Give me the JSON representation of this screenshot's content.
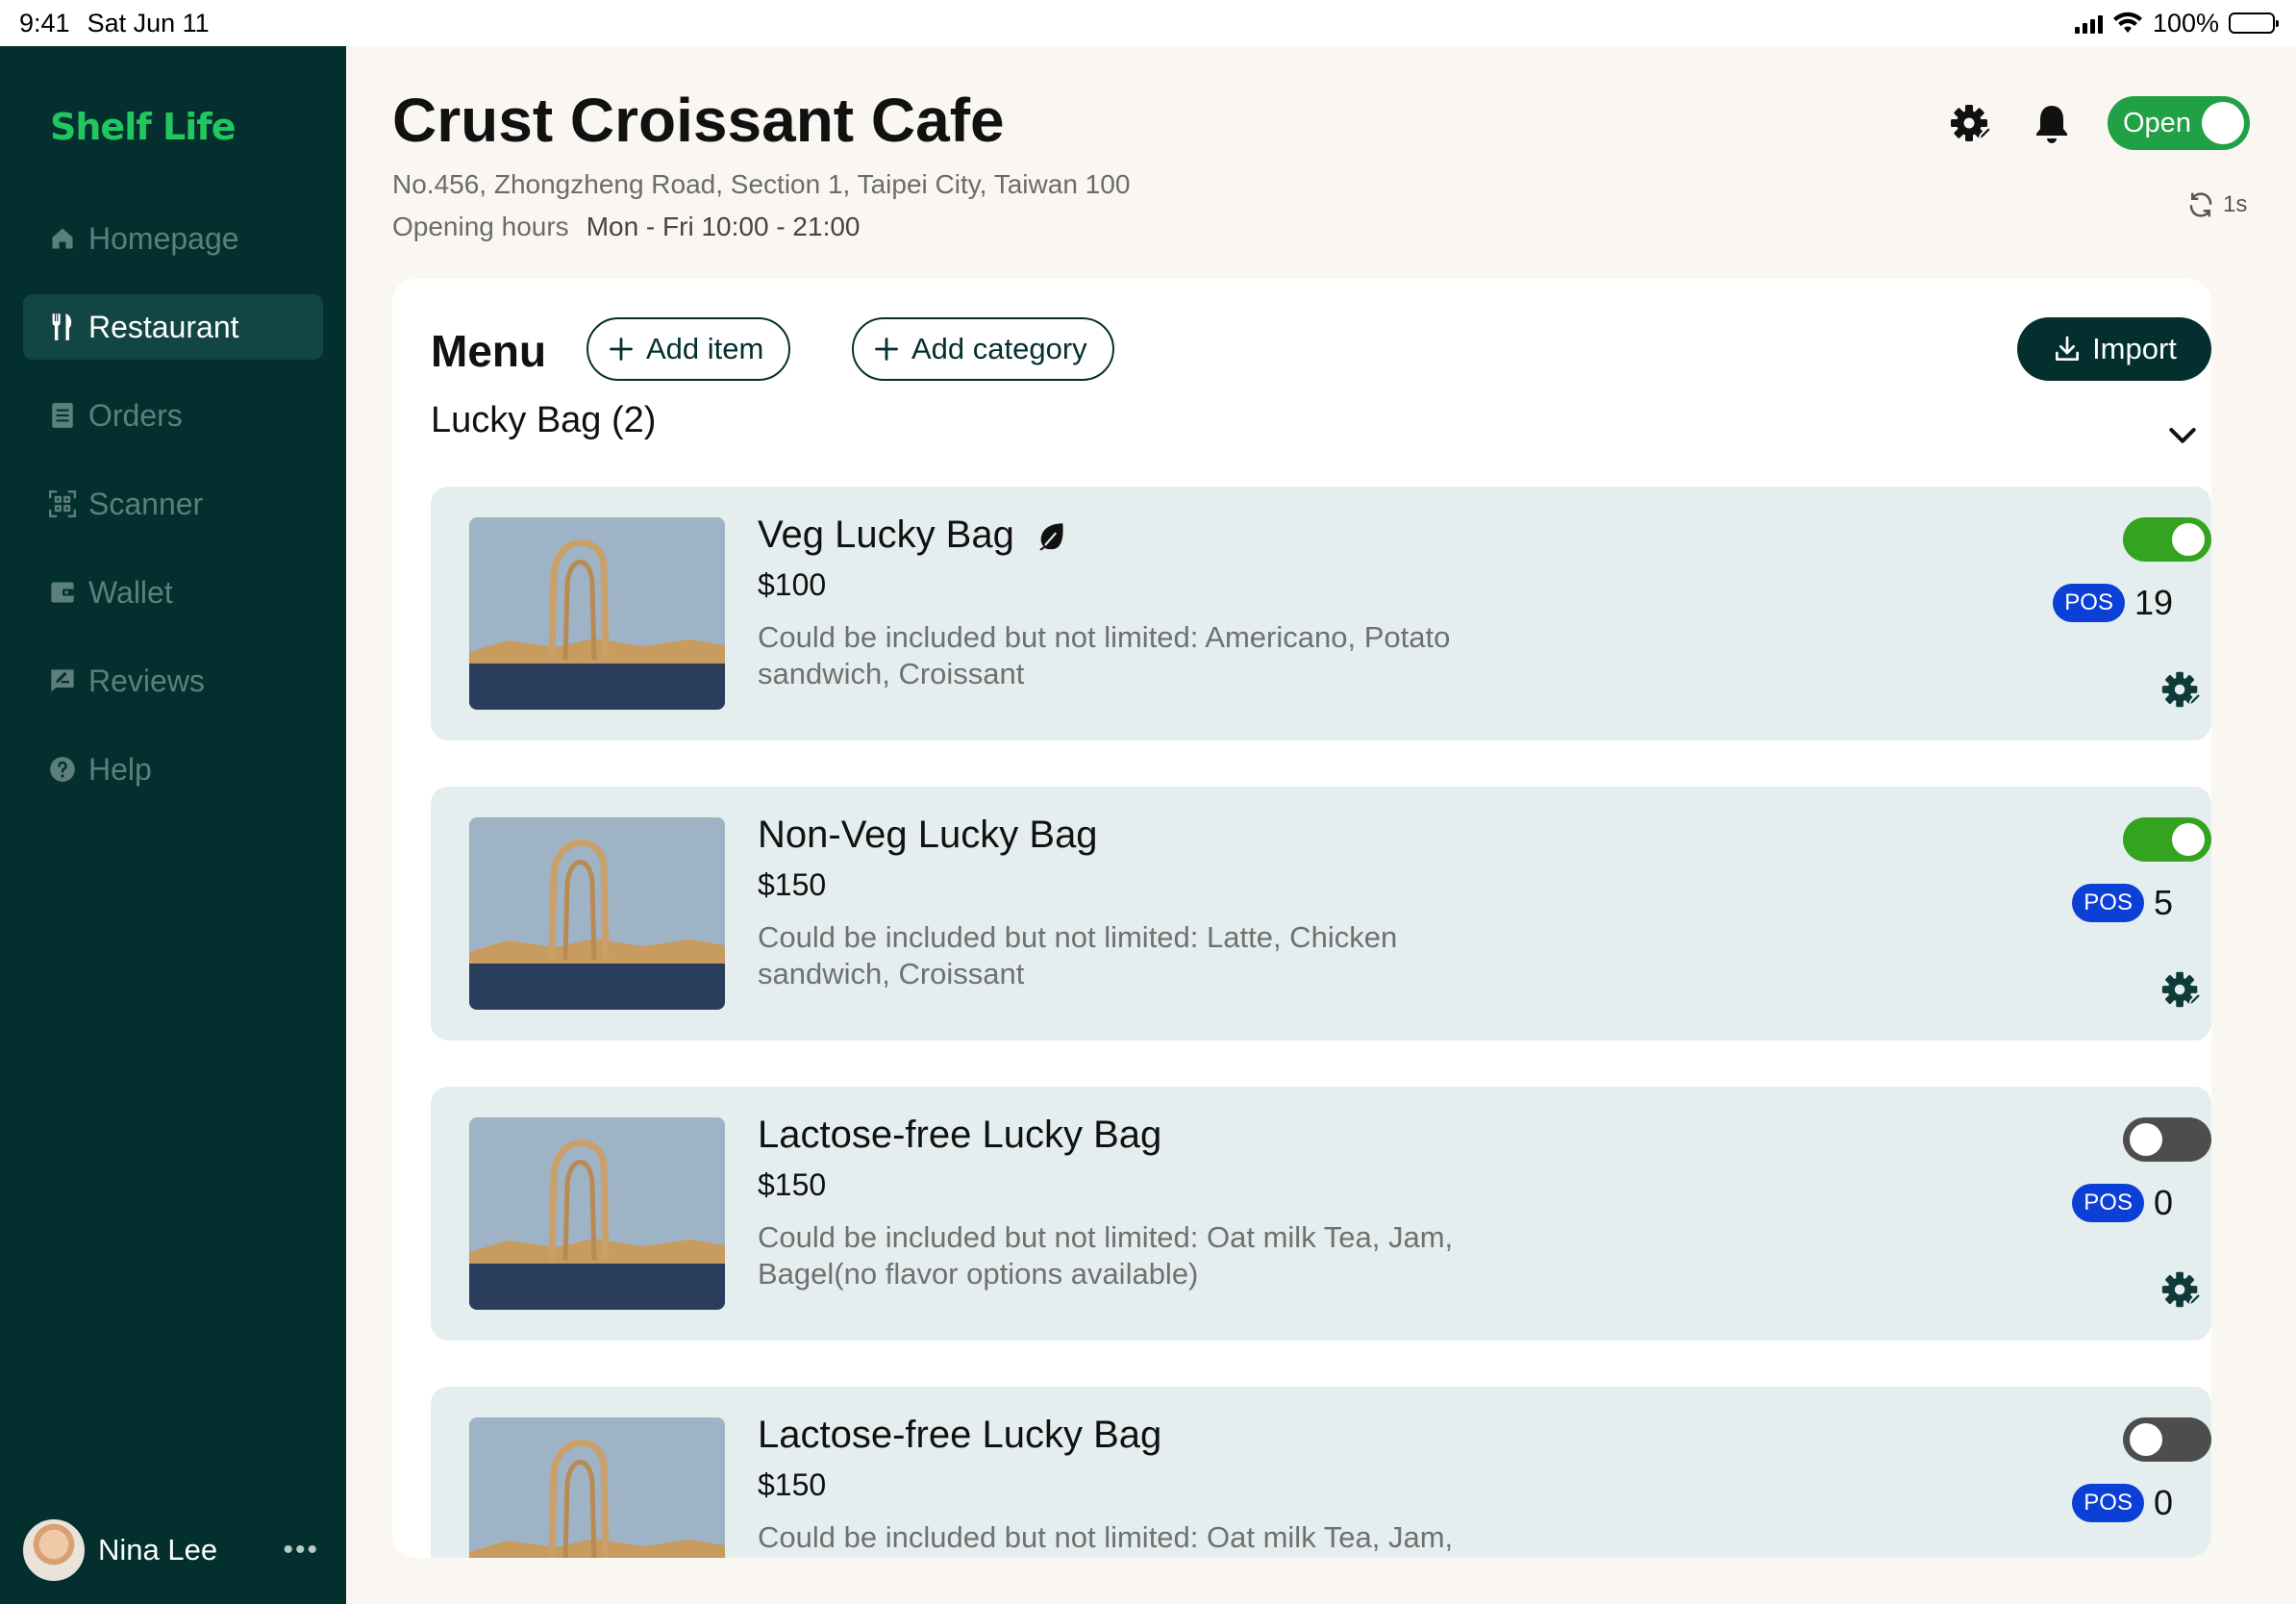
{
  "status_bar": {
    "time": "9:41",
    "date": "Sat Jun 11",
    "battery": "100%"
  },
  "sidebar": {
    "logo": "Shelf Life",
    "items": [
      {
        "label": "Homepage",
        "icon": "home-icon",
        "active": false
      },
      {
        "label": "Restaurant",
        "icon": "utensils-icon",
        "active": true
      },
      {
        "label": "Orders",
        "icon": "list-icon",
        "active": false
      },
      {
        "label": "Scanner",
        "icon": "qr-scanner-icon",
        "active": false
      },
      {
        "label": "Wallet",
        "icon": "wallet-icon",
        "active": false
      },
      {
        "label": "Reviews",
        "icon": "review-icon",
        "active": false
      },
      {
        "label": "Help",
        "icon": "help-icon",
        "active": false
      }
    ],
    "user": {
      "name": "Nina Lee",
      "more": "•••"
    }
  },
  "header": {
    "title": "Crust Croissant Cafe",
    "address": "No.456, Zhongzheng Road, Section 1, Taipei City, Taiwan 100",
    "hours_label": "Opening hours",
    "hours_value": "Mon - Fri 10:00 - 21:00",
    "open_label": "Open",
    "refresh_label": "1s"
  },
  "menu": {
    "title": "Menu",
    "add_item_label": "Add item",
    "add_category_label": "Add category",
    "import_label": "Import",
    "category_title": "Lucky Bag (2)",
    "items": [
      {
        "name": "Veg Lucky Bag",
        "veg": true,
        "price": "$100",
        "desc": "Could be included but not limited: Americano, Potato sandwich, Croissant",
        "enabled": true,
        "pos_label": "POS",
        "pos_count": "19"
      },
      {
        "name": "Non-Veg Lucky Bag",
        "veg": false,
        "price": "$150",
        "desc": "Could be included but not limited: Latte, Chicken sandwich, Croissant",
        "enabled": true,
        "pos_label": "POS",
        "pos_count": "5"
      },
      {
        "name": "Lactose-free Lucky Bag",
        "veg": false,
        "price": "$150",
        "desc": "Could be included but not limited: Oat milk Tea, Jam, Bagel(no flavor options available)",
        "enabled": false,
        "pos_label": "POS",
        "pos_count": "0"
      },
      {
        "name": "Lactose-free Lucky Bag",
        "veg": false,
        "price": "$150",
        "desc": "Could be included but not limited: Oat milk Tea, Jam,",
        "enabled": false,
        "pos_label": "POS",
        "pos_count": "0"
      }
    ]
  },
  "colors": {
    "sidebar_bg": "#03302f",
    "accent_green": "#22a046",
    "logo_green": "#22c55e",
    "pos_blue": "#0b3fd6",
    "card_bg": "#e5eeee"
  }
}
